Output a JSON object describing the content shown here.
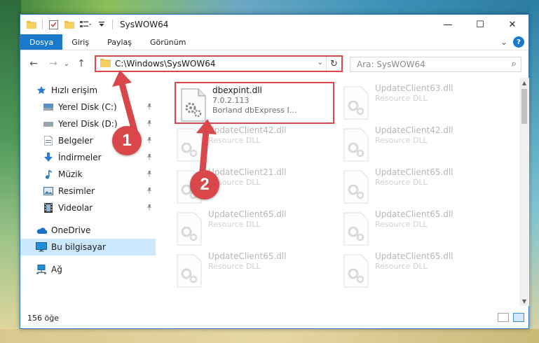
{
  "window": {
    "title": "SysWOW64",
    "minimize": "—",
    "maximize": "☐",
    "close": "✕"
  },
  "ribbon": {
    "tabs": [
      "Dosya",
      "Giriş",
      "Paylaş",
      "Görünüm"
    ],
    "expand": "⌄",
    "help": "?"
  },
  "nav": {
    "back": "←",
    "forward": "→",
    "recent": "⌄",
    "up": "↑",
    "address": "C:\\Windows\\SysWOW64",
    "address_chevron": "⌄",
    "refresh": "↻",
    "search_placeholder": "Ara: SysWOW64",
    "search_icon": "⌕"
  },
  "sidebar": {
    "items": [
      {
        "label": "Hızlı erişim",
        "icon": "star-icon",
        "pinned": false
      },
      {
        "label": "Yerel Disk (C:)",
        "icon": "drive-icon",
        "pinned": true
      },
      {
        "label": "Yerel Disk (D:)",
        "icon": "drive-icon",
        "pinned": true
      },
      {
        "label": "Belgeler",
        "icon": "document-icon",
        "pinned": true
      },
      {
        "label": "İndirmeler",
        "icon": "download-icon",
        "pinned": true
      },
      {
        "label": "Müzik",
        "icon": "music-icon",
        "pinned": true
      },
      {
        "label": "Resimler",
        "icon": "pictures-icon",
        "pinned": true
      },
      {
        "label": "Videolar",
        "icon": "video-icon",
        "pinned": true
      },
      {
        "label": "OneDrive",
        "icon": "cloud-icon",
        "pinned": false
      },
      {
        "label": "Bu bilgisayar",
        "icon": "computer-icon",
        "pinned": false
      },
      {
        "label": "Ağ",
        "icon": "network-icon",
        "pinned": false
      }
    ],
    "pin_glyph": "📌"
  },
  "files": [
    {
      "name": "dbexpint.dll",
      "line2": "7.0.2.113",
      "line3": "Borland dbExpress I...",
      "highlighted": true
    },
    {
      "name": "UpdateClient63.dll",
      "line2": "Resource DLL",
      "faded": true
    },
    {
      "name": "UpdateClient42.dll",
      "line2": "Resource DLL",
      "faded": true
    },
    {
      "name": "UpdateClient42.dll",
      "line2": "Resource DLL",
      "faded": true
    },
    {
      "name": "UpdateClient21.dll",
      "line2": "Resource DLL",
      "faded": true
    },
    {
      "name": "UpdateClient65.dll",
      "line2": "Resource DLL",
      "faded": true
    },
    {
      "name": "UpdateClient65.dll",
      "line2": "Resource DLL",
      "faded": true
    },
    {
      "name": "UpdateClient65.dll",
      "line2": "Resource DLL",
      "faded": true
    },
    {
      "name": "UpdateClient65.dll",
      "line2": "Resource DLL",
      "faded": true
    },
    {
      "name": "UpdateClient65.dll",
      "line2": "Resource DLL",
      "faded": true
    }
  ],
  "status": {
    "count": "156 öğe"
  },
  "annotations": {
    "badge1": "1",
    "badge2": "2",
    "color": "#d9474b"
  },
  "colors": {
    "accent": "#1979ca",
    "highlight": "#d9474b",
    "selection": "#cce8ff"
  }
}
